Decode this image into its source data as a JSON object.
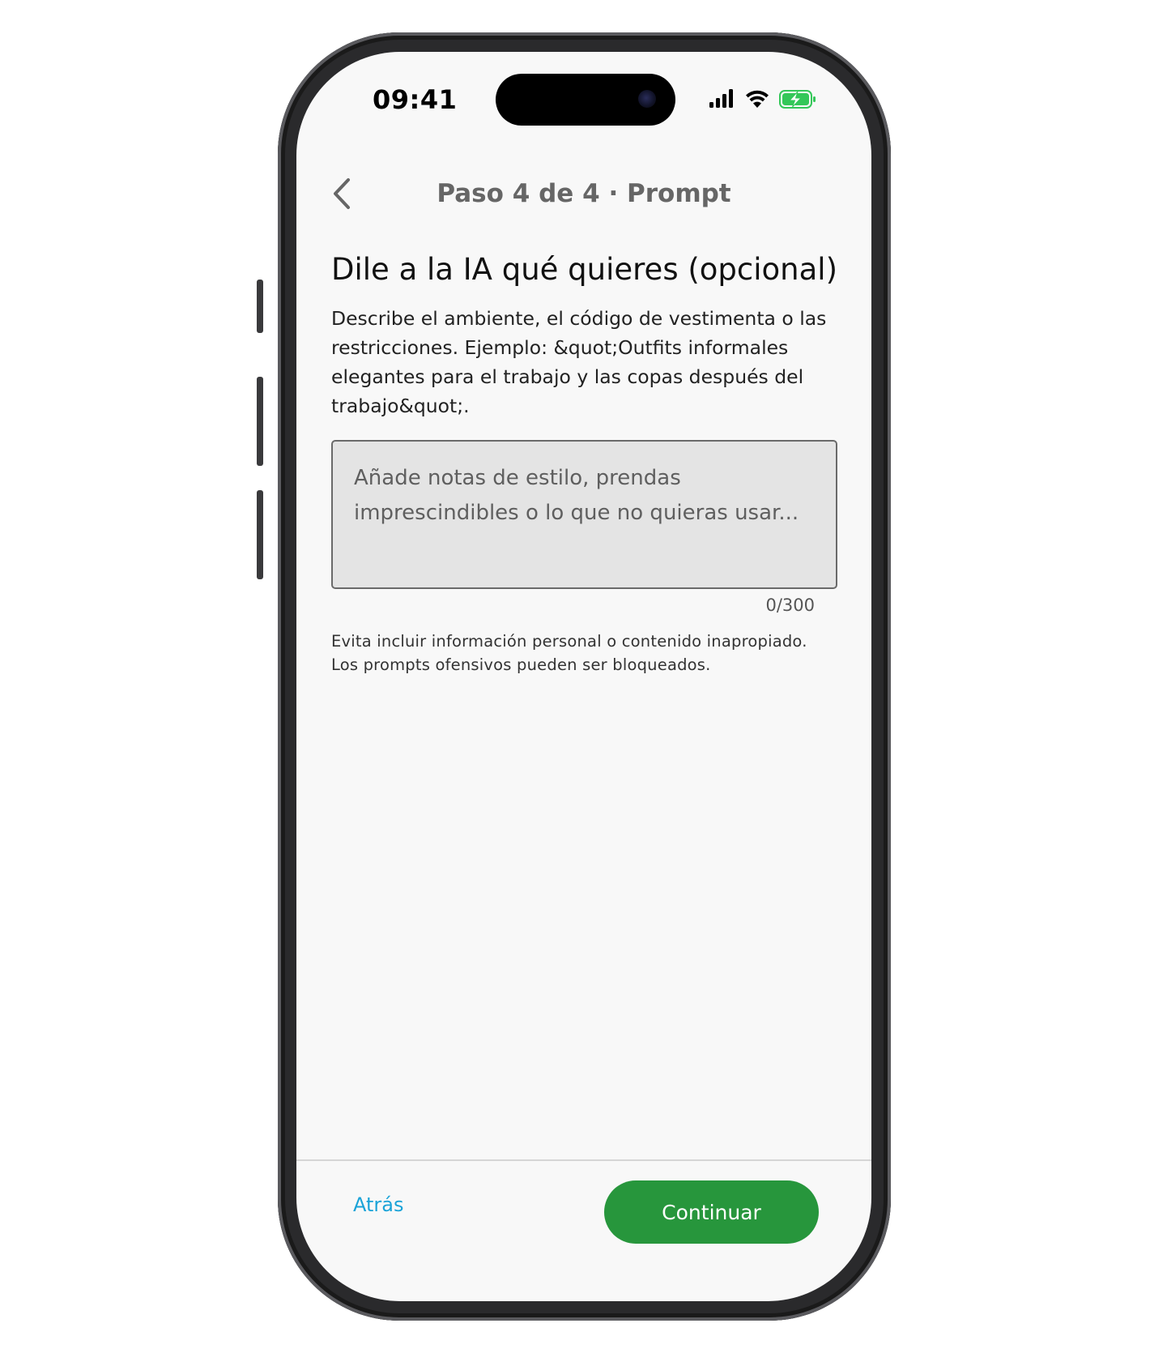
{
  "status_bar": {
    "time": "09:41"
  },
  "nav": {
    "title": "Paso 4 de 4 · Prompt",
    "back_icon": "chevron-left-icon"
  },
  "main": {
    "headline": "Dile a la IA qué quieres (opcional)",
    "description": "Describe el ambiente, el código de vestimenta o las restricciones. Ejemplo: &quot;Outfits informales elegantes para el trabajo y las copas después del trabajo&quot;.",
    "prompt_input": {
      "value": "",
      "placeholder": "Añade notas de estilo, prendas imprescindibles o lo que no quieras usar..."
    },
    "char_count": "0/300",
    "disclaimer": "Evita incluir información personal o contenido inapropiado. Los prompts ofensivos pueden ser bloqueados."
  },
  "footer": {
    "back_label": "Atrás",
    "continue_label": "Continuar"
  },
  "colors": {
    "accent_green": "#27963c",
    "link_blue": "#1aa3d8",
    "battery_green": "#34c759"
  }
}
